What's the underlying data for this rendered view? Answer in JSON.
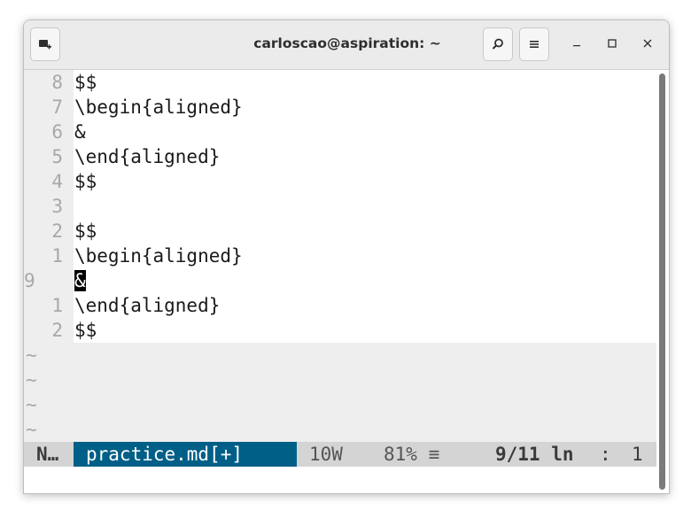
{
  "window": {
    "title": "carloscao@aspiration: ~"
  },
  "titlebar": {
    "new_tab_icon": "new-tab-icon",
    "search_icon": "search-icon",
    "menu_icon": "hamburger-menu-icon",
    "minimize": "–",
    "maximize": "□",
    "close": "✕"
  },
  "editor": {
    "lines": [
      {
        "num": "8",
        "text": "$$"
      },
      {
        "num": "7",
        "text": "\\begin{aligned}"
      },
      {
        "num": "6",
        "text": "&"
      },
      {
        "num": "5",
        "text": "\\end{aligned}"
      },
      {
        "num": "4",
        "text": "$$"
      },
      {
        "num": "3",
        "text": ""
      },
      {
        "num": "2",
        "text": "$$"
      },
      {
        "num": "1",
        "text": "\\begin{aligned}"
      },
      {
        "num": "9",
        "text": "&",
        "current": true
      },
      {
        "num": "1",
        "text": "\\end{aligned}"
      },
      {
        "num": "2",
        "text": "$$"
      }
    ],
    "tildes": [
      "~",
      "~",
      "~",
      "~"
    ]
  },
  "statusline": {
    "mode": "N…",
    "filename": "practice.md[+]",
    "words": "10W",
    "percent": "81% ≡",
    "position": "9/11 ln",
    "separator": ":",
    "column": "1",
    "colors": {
      "file_bg": "#005f87",
      "bar_bg": "#d4d4d4"
    }
  }
}
